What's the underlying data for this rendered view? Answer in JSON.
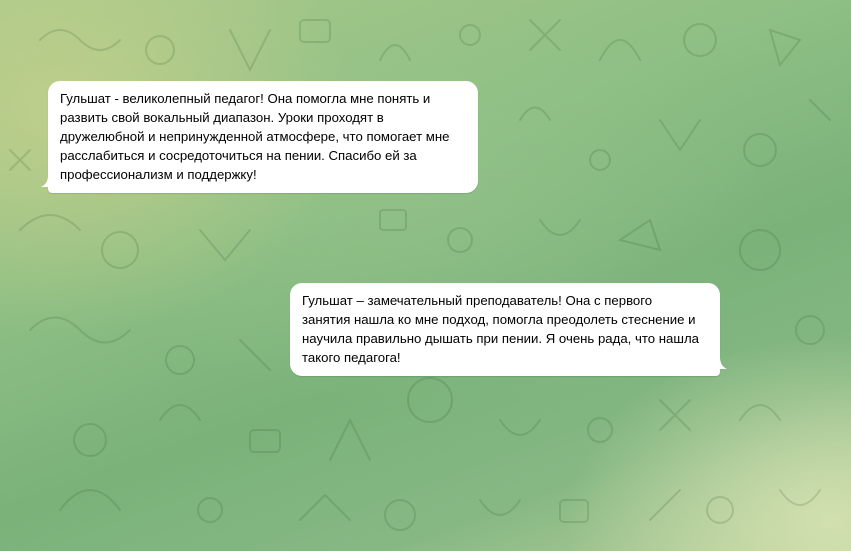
{
  "chat": {
    "messages": [
      {
        "direction": "incoming",
        "text": "Гульшат - великолепный педагог! Она помогла мне понять и\nразвить свой вокальный диапазон. Уроки проходят в\nдружелюбной и непринужденной атмосфере, что помогает мне\nрасслабиться и сосредоточиться на пении. Спасибо ей за\nпрофессионализм и поддержку!"
      },
      {
        "direction": "outgoing",
        "text": "Гульшат – замечательный преподаватель! Она с первого\nзанятия нашла ко мне подход, помогла преодолеть стеснение и\nнаучила правильно дышать при пении. Я очень рада, что нашла\nтакого педагога!"
      }
    ]
  },
  "colors": {
    "bubble": "#ffffff",
    "text": "#000000",
    "wallpaper_green": "#8ebf84",
    "wallpaper_light": "#c4d08c"
  }
}
